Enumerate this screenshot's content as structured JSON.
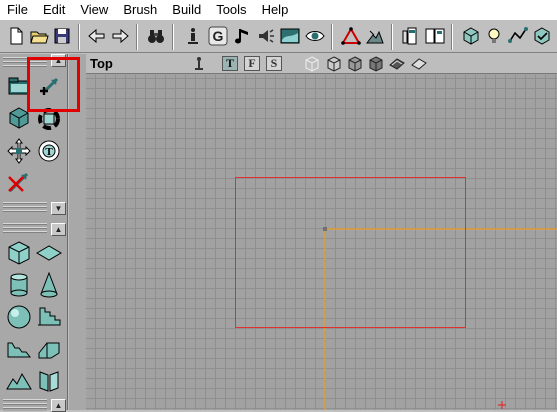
{
  "menu": [
    "File",
    "Edit",
    "View",
    "Brush",
    "Build",
    "Tools",
    "Help"
  ],
  "toolbar": {
    "icons": [
      "new-file-icon",
      "open-folder-icon",
      "save-icon",
      "undo-icon",
      "redo-icon",
      "binoculars-icon",
      "actor-properties-icon",
      "group-browser-icon",
      "music-browser-icon",
      "sound-browser-icon",
      "texture-browser-icon",
      "mesh-viewer-icon",
      "two-d-shape-editor-icon",
      "terrain-icon",
      "calculator-icon",
      "build-options-icon",
      "build-geometry-icon",
      "build-lighting-icon",
      "build-paths-icon",
      "build-all-icon"
    ]
  },
  "viewport": {
    "title": "Top",
    "modes": [
      "T",
      "F",
      "S"
    ],
    "active_mode": "T",
    "colors": {
      "grid_bg": "#a2a2a2",
      "selection": "#e03030",
      "axis": "#f0a020",
      "highlight": "#e00000"
    }
  },
  "left_panel": {
    "tools": [
      "camera-move-icon",
      "vertex-editing-icon",
      "brush-clip-icon",
      "rotate-icon",
      "scale-icon",
      "texture-pan-icon",
      "no-draw-icon",
      "cube-builder-icon",
      "sheet-builder-icon",
      "cylinder-builder-icon",
      "cone-builder-icon",
      "sphere-builder-icon",
      "linear-stair-icon",
      "curved-stair-icon",
      "spiral-stair-icon",
      "terrain-builder-icon",
      "volumetric-builder-icon"
    ]
  }
}
